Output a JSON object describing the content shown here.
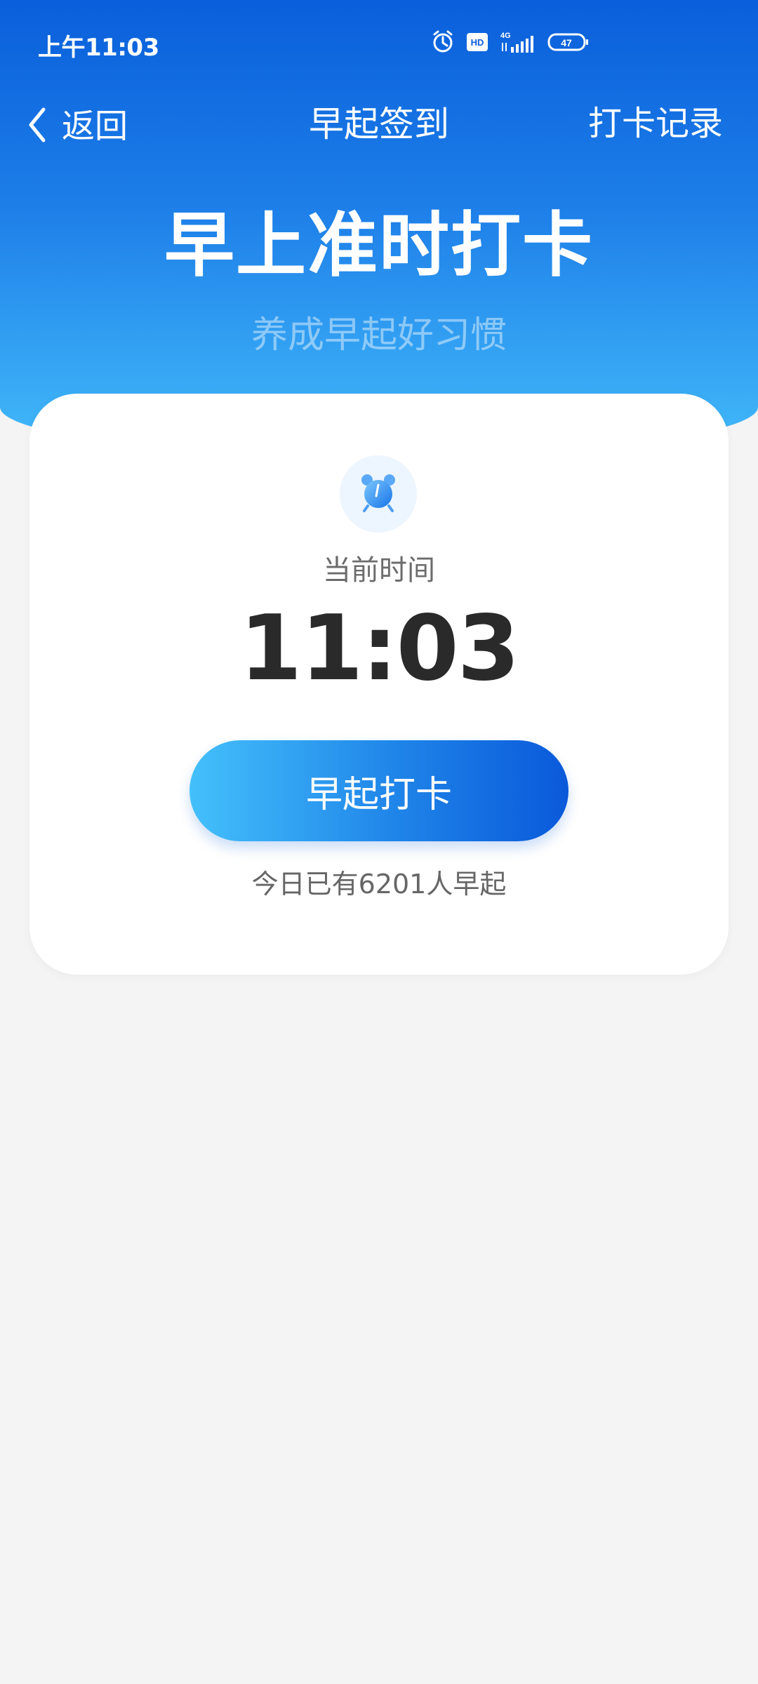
{
  "status_bar": {
    "time": "上午11:03",
    "hd": "HD",
    "network": "4G",
    "battery": "47"
  },
  "nav": {
    "back_label": "返回",
    "title": "早起签到",
    "record_label": "打卡记录"
  },
  "hero": {
    "title": "早上准时打卡",
    "subtitle": "养成早起好习惯"
  },
  "card": {
    "current_label": "当前时间",
    "current_time": "11:03",
    "checkin_button": "早起打卡",
    "count_text": "今日已有6201人早起"
  },
  "icons": {
    "alarm": "alarm-icon",
    "back": "chevron-left-icon",
    "hd": "hd-icon",
    "signal": "signal-icon",
    "battery": "battery-icon"
  },
  "colors": {
    "primary_dark": "#0a5fdb",
    "primary_light": "#43bbfa",
    "background": "#f4f4f4",
    "text_dark": "#2a2a2a",
    "text_muted": "#666666"
  }
}
